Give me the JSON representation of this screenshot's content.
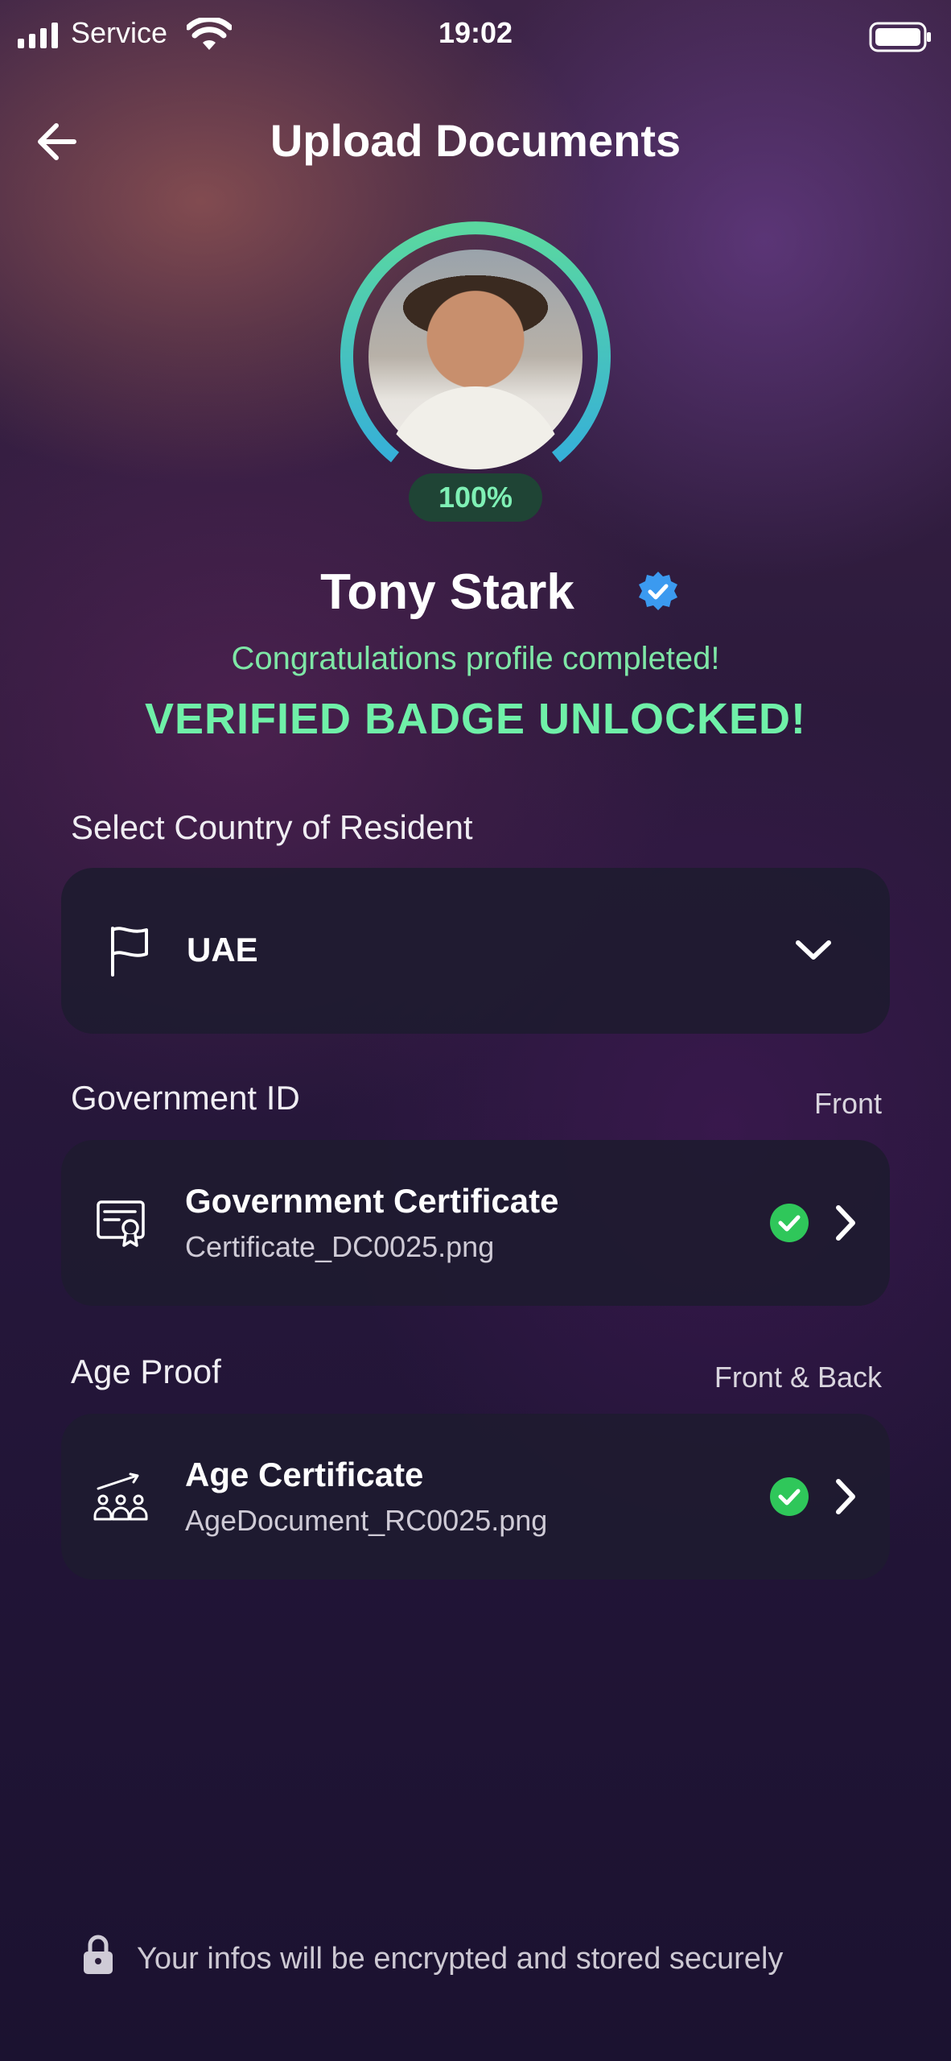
{
  "status_bar": {
    "carrier": "Service",
    "time": "19:02"
  },
  "header": {
    "title": "Upload Documents"
  },
  "profile": {
    "progress": "100%",
    "progress_value": 1.0,
    "name": "Tony Stark",
    "congrats": "Congratulations profile completed!",
    "badge_text": "VERIFIED BADGE UNLOCKED!"
  },
  "country": {
    "label": "Select Country of Resident",
    "value": "UAE"
  },
  "government_id": {
    "label": "Government ID",
    "side": "Front",
    "title": "Government Certificate",
    "file": "Certificate_DC0025.png"
  },
  "age_proof": {
    "label": "Age Proof",
    "side": "Front & Back",
    "title": "Age Certificate",
    "file": "AgeDocument_RC0025.png"
  },
  "footer": {
    "text": "Your infos will be encrypted and stored securely"
  },
  "colors": {
    "accent_green": "#6ff0a8",
    "ring_start": "#4fd1b0",
    "ring_end": "#38b6d8",
    "check_green": "#2fc75a",
    "verified_blue": "#3b9af0"
  },
  "icons": {
    "back": "arrow-left-icon",
    "verified": "verified-badge-icon",
    "flag": "flag-icon",
    "dropdown": "chevron-down-icon",
    "certificate": "certificate-icon",
    "age": "people-growth-icon",
    "check": "check-circle-icon",
    "next": "chevron-right-icon",
    "lock": "lock-icon"
  }
}
